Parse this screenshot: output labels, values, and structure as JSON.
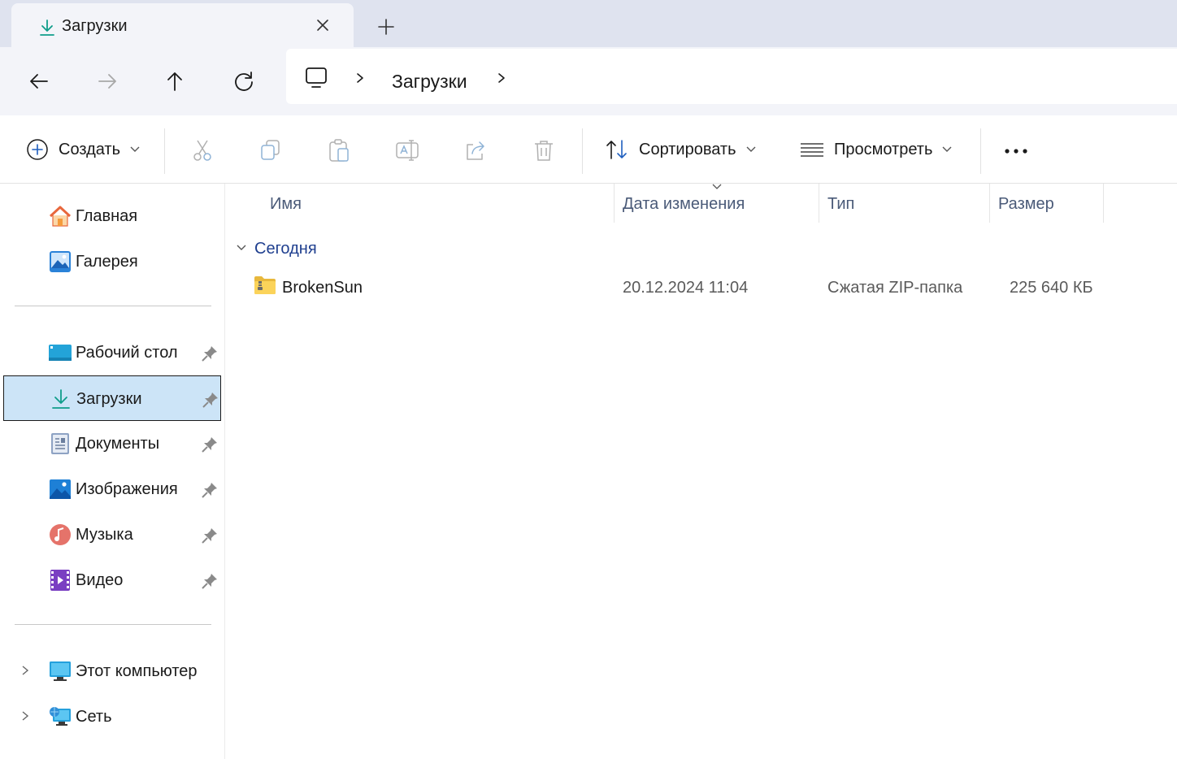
{
  "tab": {
    "title": "Загрузки",
    "icon": "download-icon"
  },
  "address": {
    "root_icon": "computer-icon",
    "crumb": "Загрузки"
  },
  "commands": {
    "create": "Создать",
    "sort": "Сортировать",
    "view": "Просмотреть",
    "more_icon": "more-icon"
  },
  "sidebar": {
    "quick": [
      {
        "label": "Главная",
        "icon": "home-icon"
      },
      {
        "label": "Галерея",
        "icon": "gallery-icon"
      }
    ],
    "pinned": [
      {
        "label": "Рабочий стол",
        "icon": "desktop-icon"
      },
      {
        "label": "Загрузки",
        "icon": "download-icon",
        "selected": true
      },
      {
        "label": "Документы",
        "icon": "documents-icon"
      },
      {
        "label": "Изображения",
        "icon": "pictures-icon"
      },
      {
        "label": "Музыка",
        "icon": "music-icon"
      },
      {
        "label": "Видео",
        "icon": "video-icon"
      }
    ],
    "locations": [
      {
        "label": "Этот компьютер",
        "icon": "computer-icon"
      },
      {
        "label": "Сеть",
        "icon": "network-icon"
      }
    ]
  },
  "columns": {
    "name": "Имя",
    "date": "Дата изменения",
    "type": "Тип",
    "size": "Размер"
  },
  "groups": [
    {
      "label": "Сегодня",
      "files": [
        {
          "name": "BrokenSun",
          "date": "20.12.2024 11:04",
          "type": "Сжатая ZIP-папка",
          "size": "225 640 КБ",
          "icon": "zip-folder-icon"
        }
      ]
    }
  ],
  "colors": {
    "accent": "#0f9d8a",
    "selection": "#cce4f7",
    "group_text": "#1f3f8f"
  }
}
